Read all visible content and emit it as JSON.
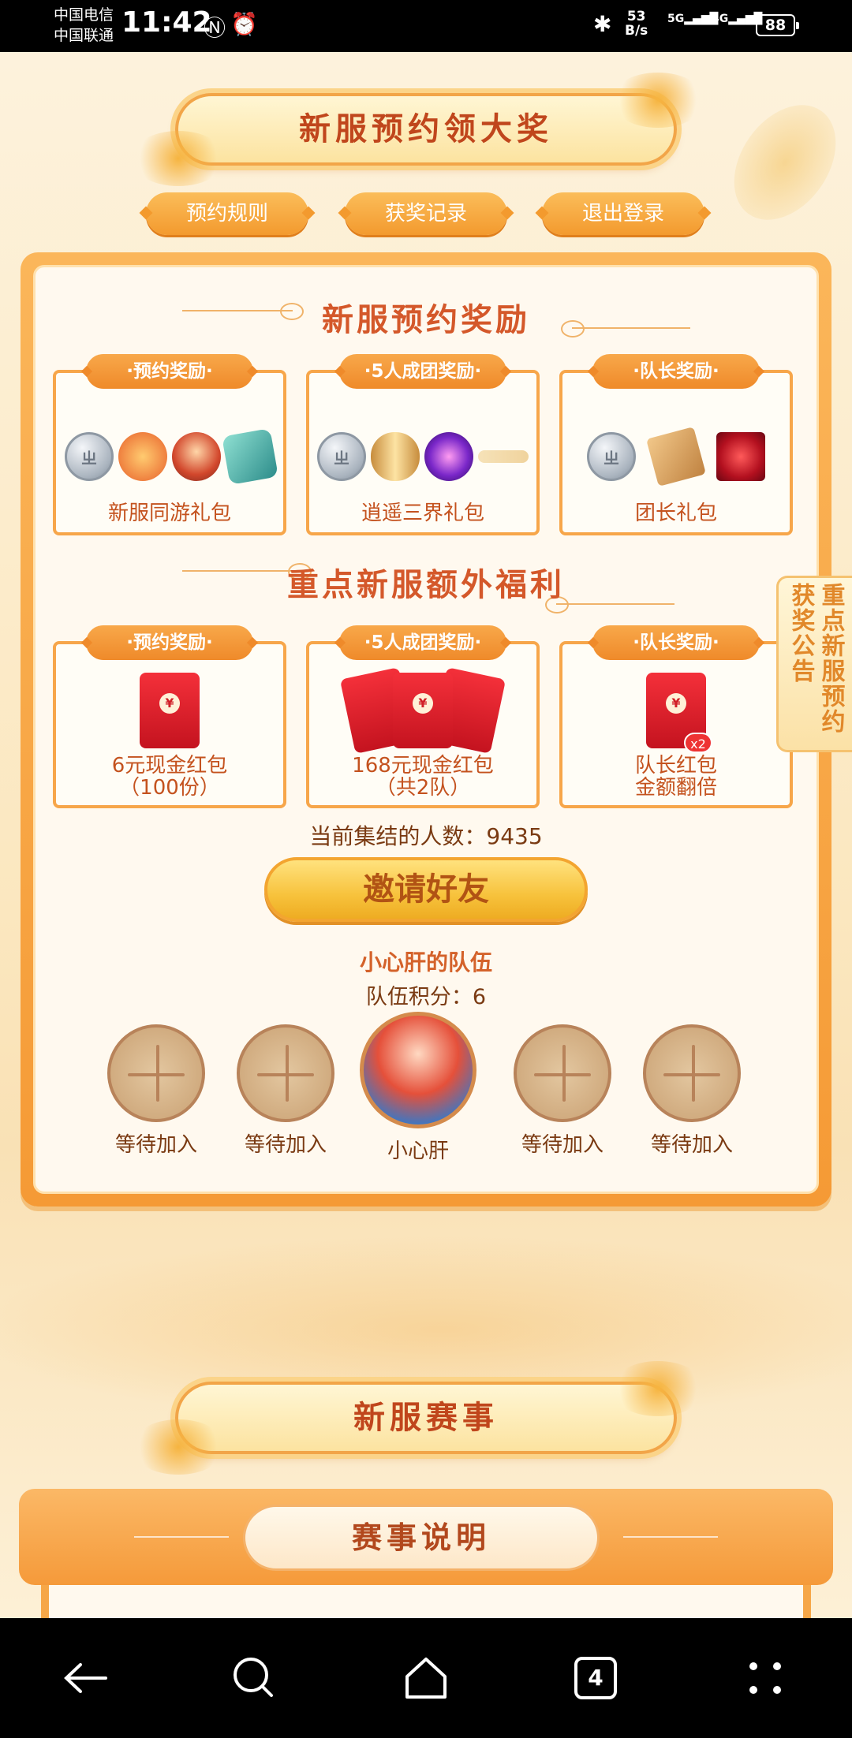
{
  "status": {
    "carrier1": "中国电信",
    "carrier2": "中国联通",
    "time": "11:42",
    "speed_value": "53",
    "speed_unit": "B/s",
    "net1": "5G",
    "net2": "4G",
    "battery": "88"
  },
  "header": {
    "title": "新服预约领大奖",
    "buttons": [
      "预约规则",
      "获奖记录",
      "退出登录"
    ]
  },
  "reward_section": {
    "title": "新服预约奖励",
    "cards": [
      {
        "tag": "·预约奖励·",
        "label": "新服同游礼包"
      },
      {
        "tag": "·5人成团奖励·",
        "label": "逍遥三界礼包"
      },
      {
        "tag": "·队长奖励·",
        "label": "团长礼包"
      }
    ]
  },
  "bonus_section": {
    "title": "重点新服额外福利",
    "cards": [
      {
        "tag": "·预约奖励·",
        "label1": "6元现金红包",
        "label2": "（100份）"
      },
      {
        "tag": "·5人成团奖励·",
        "label1": "168元现金红包",
        "label2": "（共2队）"
      },
      {
        "tag": "·队长奖励·",
        "label1": "队长红包",
        "label2": "金额翻倍",
        "badge": "x2"
      }
    ],
    "currency_symbol": "¥"
  },
  "gather": {
    "label": "当前集结的人数：",
    "count": "9435"
  },
  "invite_button": "邀请好友",
  "team": {
    "name": "小心肝的队伍",
    "score_label": "队伍积分：",
    "score": "6",
    "members": [
      "等待加入",
      "等待加入",
      "小心肝",
      "等待加入",
      "等待加入"
    ]
  },
  "side_tab": {
    "col1": "重点新服预约",
    "col2": "获奖公告"
  },
  "event": {
    "title": "新服赛事",
    "button": "赛事说明"
  },
  "navbar": {
    "tabs_count": "4"
  },
  "colors": {
    "accent": "#f59a35",
    "title_red": "#c0461c",
    "background": "#fdf0d6"
  }
}
